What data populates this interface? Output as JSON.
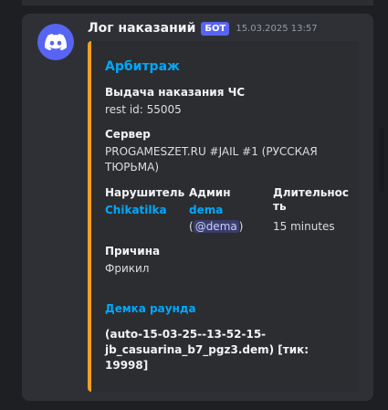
{
  "message": {
    "author": "Лог наказаний",
    "bot_tag": "БОТ",
    "timestamp": "15.03.2025 13:57",
    "avatar_icon": "discord-logo-icon",
    "colors": {
      "accent": "#f0a020",
      "link": "#00a8fc",
      "bot_tag": "#5865f2"
    }
  },
  "embed": {
    "title": "Арбитраж",
    "fields": {
      "punishment": {
        "name": "Выдача наказания ЧС",
        "value": "rest id: 55005"
      },
      "server": {
        "name": "Сервер",
        "value_line1": "PROGAMESZET.RU #JAIL #1 (РУССКАЯ",
        "value_line2": "ТЮРЬМА)"
      },
      "violator": {
        "name": "Нарушитель",
        "value": "Chikatilka"
      },
      "admin": {
        "name": "Админ",
        "value": "dema",
        "paren_open": "(",
        "mention": "@dema",
        "paren_close": ")"
      },
      "duration": {
        "name_line1": "Длительнос",
        "name_line2": "ть",
        "value": "15 minutes"
      },
      "reason": {
        "name": "Причина",
        "value": "Фрикил"
      }
    },
    "demo": {
      "link_text": "Демка раунда",
      "line1": "(auto-15-03-25--13-52-15-",
      "line2": "jb_casuarina_b7_pgz3.dem) [тик: 19998]"
    }
  }
}
